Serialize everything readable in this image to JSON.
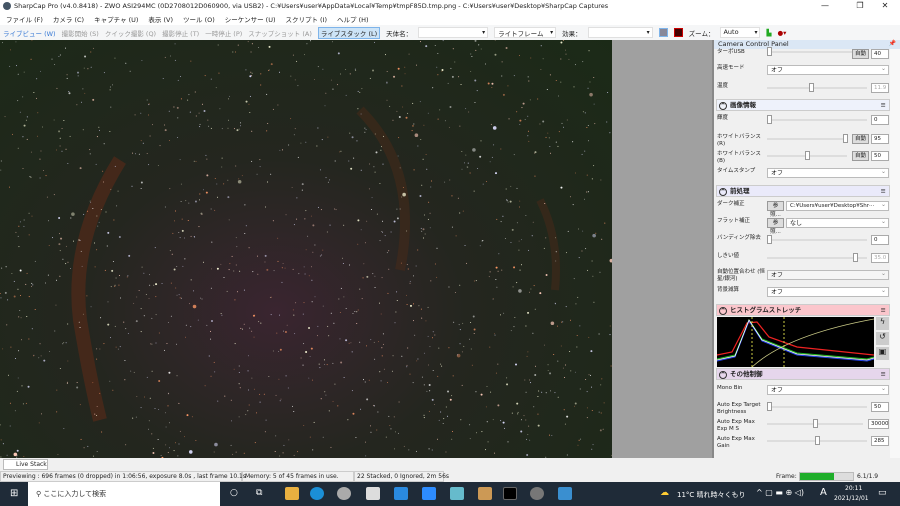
{
  "window": {
    "title": "SharpCap Pro (v4.0.8418) - ZWO ASI294MC (0D2708012D060900, via USB2) - C:¥Users¥user¥AppData¥Local¥Temp¥tmpF85D.tmp.png - C:¥Users¥user¥Desktop¥SharpCap Captures",
    "minimize": "—",
    "maximize": "❐",
    "close": "✕"
  },
  "menu": [
    "ファイル (F)",
    "カメラ (C)",
    "キャプチャ (U)",
    "表示 (V)",
    "ツール (O)",
    "シーケンサー (U)",
    "スクリプト (I)",
    "ヘルプ (H)"
  ],
  "toolbar": {
    "live_view": "ライブビュー (W)",
    "start_capture": "撮影開始 (S)",
    "quick_capture": "クイック撮影 (Q)",
    "stop_capture": "撮影停止 (T)",
    "pause": "一時停止 (P)",
    "snapshot": "スナップショット (A)",
    "live_stack": "ライブスタック (L)",
    "target_label": "天体名：",
    "target_value": "",
    "frame_type": "ライトフレーム",
    "effect_label": "効果：",
    "effect_value": "",
    "zoom_label": "ズーム：",
    "zoom_value": "Auto"
  },
  "panel": {
    "title": "Camera Control Panel",
    "turbo_usb": {
      "label": "ターボUSB",
      "auto": "自動",
      "value": "40"
    },
    "high_speed": {
      "label": "高速モード",
      "value": "オフ"
    },
    "temperature": {
      "label": "温度",
      "value": "11.9"
    },
    "image_section": "画像情報",
    "brightness": {
      "label": "輝度",
      "value": "0",
      "pos": 0
    },
    "wb_r": {
      "label": "ホワイトバランス(R)",
      "auto": "自動",
      "value": "95",
      "pos": 0.95
    },
    "wb_b": {
      "label": "ホワイトバランス(B)",
      "auto": "自動",
      "value": "50",
      "pos": 0.5
    },
    "timestamp": {
      "label": "タイムスタンプ",
      "value": "オフ"
    },
    "pre_section": "前処理",
    "dark": {
      "label": "ダーク補正",
      "browse": "参照...",
      "value": "C:¥Users¥user¥Desktop¥Shr···"
    },
    "flat": {
      "label": "フラット補正",
      "browse": "参照...",
      "value": "なし"
    },
    "banding": {
      "label": "バンディング除去",
      "value": "0"
    },
    "threshold": {
      "label": "しきい値",
      "value": "35.0"
    },
    "auto_align": {
      "label": "自動位置合わせ (恒星/銀河)",
      "value": "オフ"
    },
    "bg_sub": {
      "label": "背景減算",
      "value": "オフ"
    },
    "hist_section": "ヒストグラムストレッチ",
    "other_section": "その他制御",
    "mono_bin": {
      "label": "Mono Bin",
      "value": "オフ"
    },
    "ae_target": {
      "label": "Auto Exp Target Brightness",
      "value": "50"
    },
    "ae_max_exp": {
      "label": "Auto Exp Max Exp M S",
      "value": "30000"
    },
    "ae_max_gain": {
      "label": "Auto Exp Max Gain",
      "value": "285"
    }
  },
  "live_stack_tab": "Live Stack",
  "status": {
    "preview": "Previewing : 696 frames (0 dropped) in 1:06:56, exposure 8.0s , last frame 10.1s",
    "memory": "Memory: 5 of 45 frames in use.",
    "stacked": "22 Stacked, 0 Ignored, 2m 56s",
    "frame_label": "Frame:",
    "frame_progress": 0.65,
    "frame_rate": "6.1/1.9"
  },
  "taskbar": {
    "search": "ここに入力して検索",
    "weather": "11°C 晴れ時々くもり",
    "ime": "A",
    "time": "20:11",
    "date": "2021/12/01"
  }
}
